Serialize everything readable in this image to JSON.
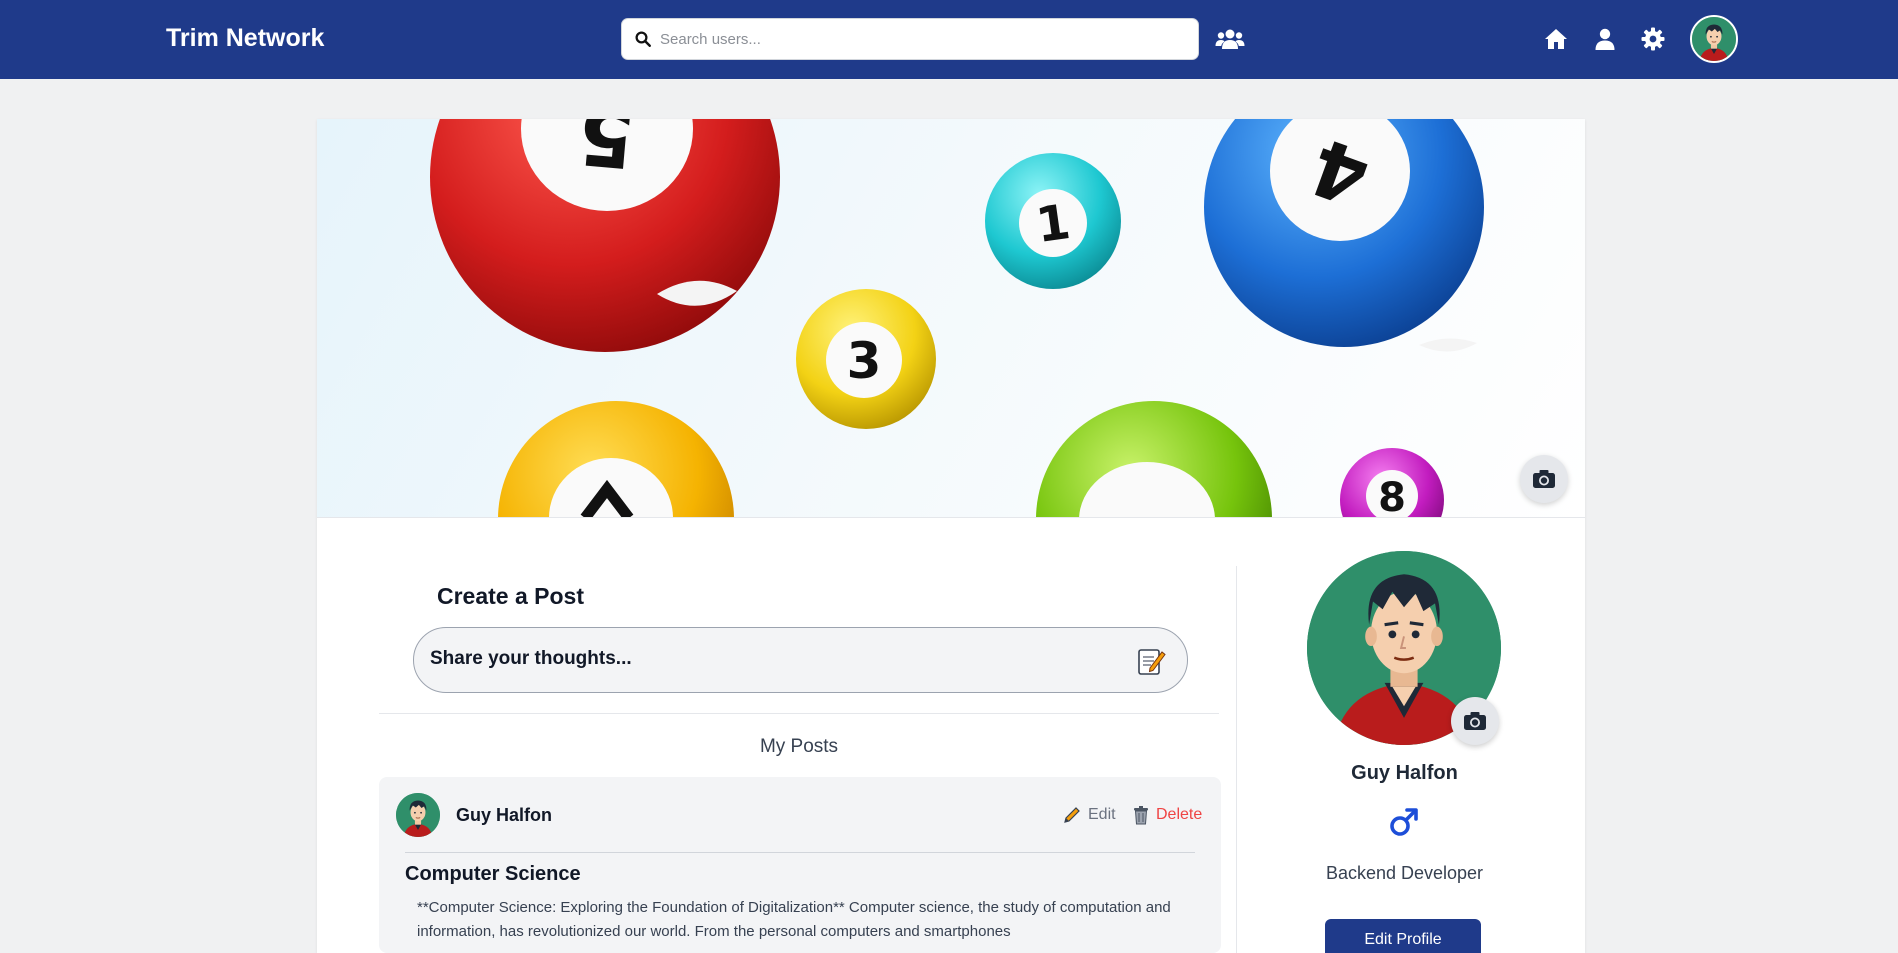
{
  "header": {
    "brand": "Trim Network",
    "search_placeholder": "Search users...",
    "icons": [
      "search-icon",
      "users-icon",
      "home-icon",
      "user-icon",
      "gear-icon",
      "avatar"
    ]
  },
  "cover": {
    "balls": [
      "5",
      "1",
      "4",
      "3",
      "8"
    ]
  },
  "create_post": {
    "title": "Create a Post",
    "prompt": "Share your thoughts..."
  },
  "posts_section": {
    "heading": "My Posts",
    "posts": [
      {
        "author": "Guy Halfon",
        "edit_label": "Edit",
        "delete_label": "Delete",
        "title": "Computer Science",
        "body": "**Computer Science: Exploring the Foundation of Digitalization** Computer science, the study of computation and information, has revolutionized our world. From the personal computers and smartphones"
      }
    ]
  },
  "profile": {
    "name": "Guy Halfon",
    "gender_symbol": "male",
    "role": "Backend Developer",
    "edit_button": "Edit Profile"
  },
  "colors": {
    "header_bg": "#1f3a8a",
    "accent": "#1f3a8a",
    "delete": "#ef4444",
    "avatar_bg": "#2f8f6a",
    "gender": "#1d4ed8"
  }
}
